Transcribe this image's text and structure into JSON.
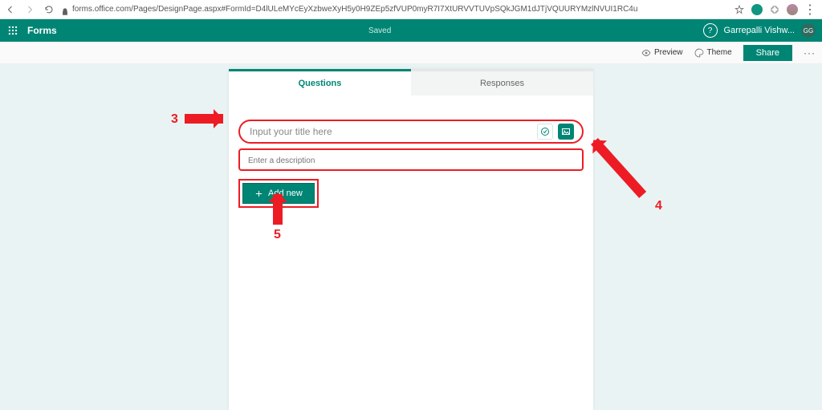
{
  "browser": {
    "url": "forms.office.com/Pages/DesignPage.aspx#FormId=D4lULeMYcEyXzbweXyH5y0H9ZEp5zfVUP0myR7I7XtURVVTUVpSQkJGM1dJTjVQUURYMzlNVUI1RC4u"
  },
  "header": {
    "app_name": "Forms",
    "status": "Saved",
    "help": "?",
    "user_name": "Garrepalli Vishw...",
    "avatar_initials": "GG"
  },
  "toolbar": {
    "preview": "Preview",
    "theme": "Theme",
    "share": "Share",
    "more": "···"
  },
  "tabs": {
    "questions": "Questions",
    "responses": "Responses"
  },
  "form": {
    "title_placeholder": "Input your title here",
    "desc_placeholder": "Enter a description",
    "add_new": "Add new"
  },
  "annotations": {
    "n3": "3",
    "n4": "4",
    "n5": "5"
  }
}
